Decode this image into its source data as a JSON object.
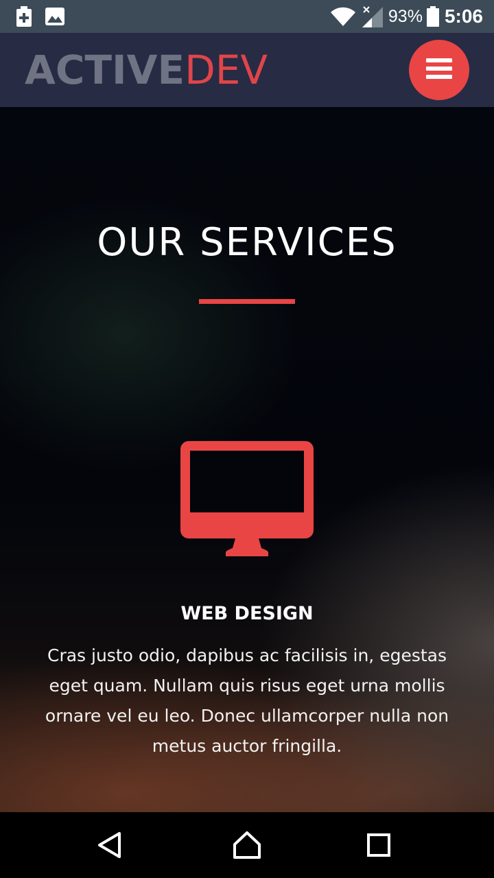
{
  "status_bar": {
    "battery_percent": "93%",
    "time": "5:06",
    "icons": [
      "battery-saver-icon",
      "gallery-icon",
      "wifi-icon",
      "cell-signal-icon",
      "battery-icon"
    ]
  },
  "header": {
    "logo_part1": "ACTIVE",
    "logo_part2": "DEV",
    "menu_icon": "hamburger-icon"
  },
  "hero": {
    "title": "OUR SERVICES",
    "service": {
      "icon": "monitor-icon",
      "title": "WEB DESIGN",
      "description": "Cras justo odio, dapibus ac facilisis in, egestas eget quam. Nullam quis risus eget urna mollis ornare vel eu leo. Donec ullamcorper nulla non metus auctor fringilla."
    }
  },
  "nav_bar": {
    "icons": [
      "back-icon",
      "home-icon",
      "recents-icon"
    ]
  },
  "colors": {
    "accent": "#e94545",
    "header_bg": "#272b44",
    "status_bg": "#3c4b57",
    "logo_gray": "#6f7383"
  }
}
